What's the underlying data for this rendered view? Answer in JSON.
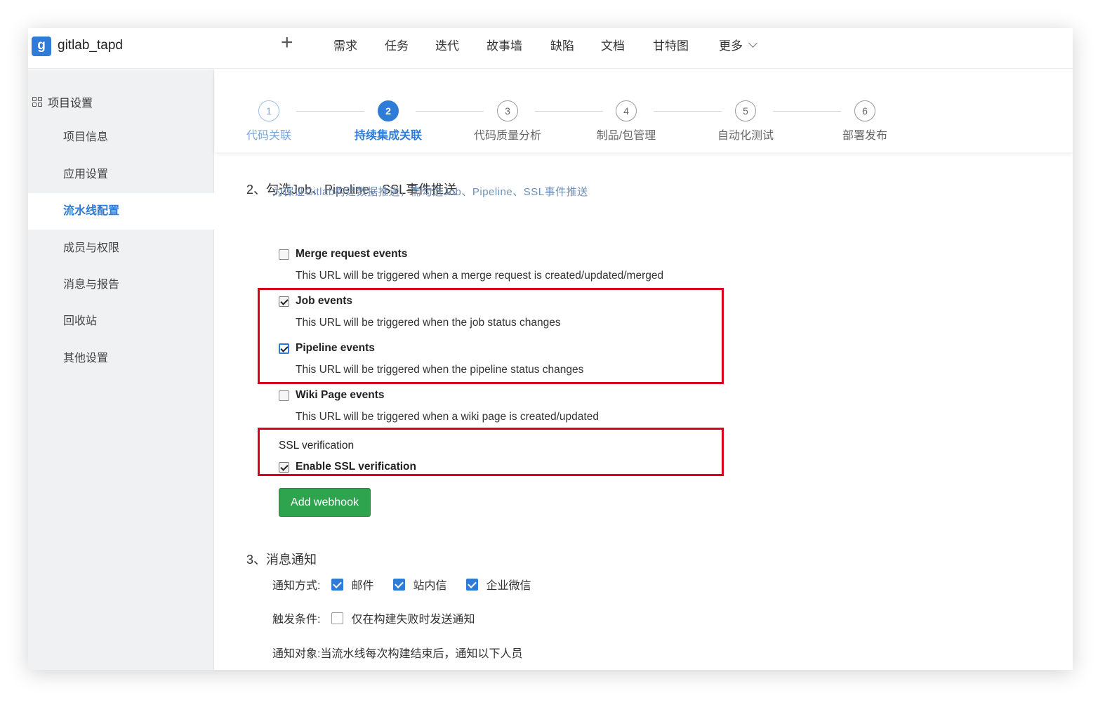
{
  "app": {
    "logo_letter": "g",
    "project_name": "gitlab_tapd"
  },
  "topnav": {
    "add_icon": "plus-icon",
    "items": [
      "需求",
      "任务",
      "迭代",
      "故事墙",
      "缺陷",
      "文档",
      "甘特图"
    ],
    "more_label": "更多"
  },
  "sidebar": {
    "title": "项目设置",
    "items": [
      "项目信息",
      "应用设置",
      "流水线配置",
      "成员与权限",
      "消息与报告",
      "回收站",
      "其他设置"
    ],
    "active_item": "流水线配置"
  },
  "steps": [
    {
      "num": "1",
      "label": "代码关联",
      "state": "done"
    },
    {
      "num": "2",
      "label": "持续集成关联",
      "state": "current"
    },
    {
      "num": "3",
      "label": "代码质量分析",
      "state": "todo"
    },
    {
      "num": "4",
      "label": "制品/包管理",
      "state": "todo"
    },
    {
      "num": "5",
      "label": "自动化测试",
      "state": "todo"
    },
    {
      "num": "6",
      "label": "部署发布",
      "state": "todo"
    }
  ],
  "section2": {
    "title": "2、勾选Job、Pipeline、SSL事件推送",
    "hint": "为保证Gitlab构建数据推送，需勾选Job、Pipeline、SSL事件推送",
    "options": [
      {
        "label": "Merge request events",
        "desc": "This URL will be triggered when a merge request is created/updated/merged",
        "checked": false
      },
      {
        "label": "Job events",
        "desc": "This URL will be triggered when the job status changes",
        "checked": true
      },
      {
        "label": "Pipeline events",
        "desc": "This URL will be triggered when the pipeline status changes",
        "checked": true
      },
      {
        "label": "Wiki Page events",
        "desc": "This URL will be triggered when a wiki page is created/updated",
        "checked": false
      }
    ],
    "ssl_label": "SSL verification",
    "ssl_option": "Enable SSL verification",
    "ssl_checked": true,
    "add_button": "Add webhook"
  },
  "section3": {
    "title": "3、消息通知",
    "method_label": "通知方式:",
    "methods": [
      "邮件",
      "站内信",
      "企业微信"
    ],
    "trigger_label": "触发条件:",
    "trigger_option": "仅在构建失败时发送通知",
    "target_label": "通知对象:",
    "target_text": "当流水线每次构建结束后，通知以下人员"
  },
  "colors": {
    "accent": "#2f7bd8",
    "highlight": "#d9001b",
    "button": "#2ea44f"
  }
}
